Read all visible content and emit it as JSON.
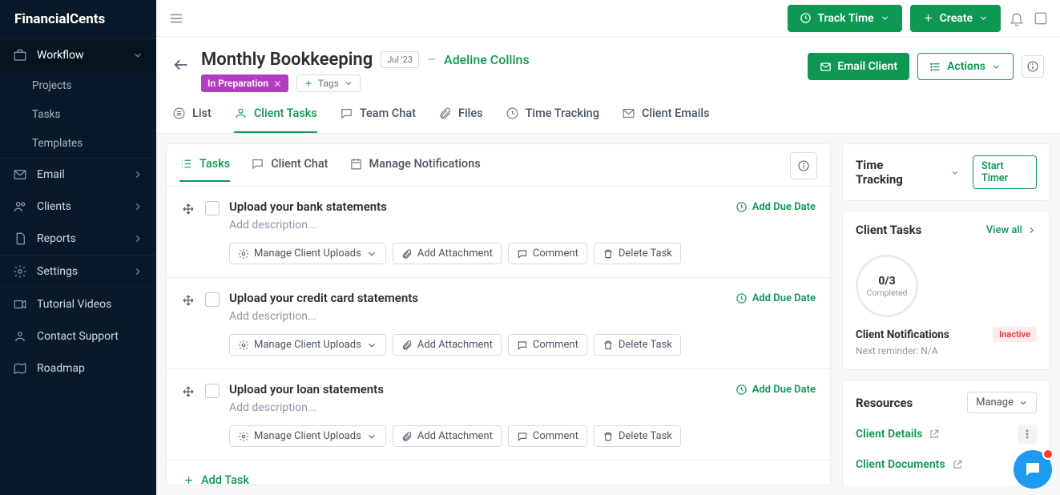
{
  "brand": "FinancialCents",
  "sidebar": {
    "workflow": "Workflow",
    "sub": {
      "projects": "Projects",
      "tasks": "Tasks",
      "templates": "Templates"
    },
    "email": "Email",
    "clients": "Clients",
    "reports": "Reports",
    "settings": "Settings",
    "tutorial": "Tutorial Videos",
    "support": "Contact Support",
    "roadmap": "Roadmap"
  },
  "top": {
    "trackTime": "Track Time",
    "create": "Create"
  },
  "header": {
    "title": "Monthly Bookkeeping",
    "period": "Jul '23",
    "client": "Adeline Collins",
    "status": "In Preparation",
    "tags": "Tags",
    "emailClient": "Email Client",
    "actions": "Actions"
  },
  "ptabs": {
    "list": "List",
    "clientTasks": "Client Tasks",
    "teamChat": "Team Chat",
    "files": "Files",
    "timeTracking": "Time Tracking",
    "clientEmails": "Client Emails"
  },
  "subtabs": {
    "tasks": "Tasks",
    "clientChat": "Client Chat",
    "manageNotif": "Manage Notifications"
  },
  "taskBtns": {
    "manageUploads": "Manage Client Uploads",
    "addAttachment": "Add Attachment",
    "comment": "Comment",
    "deleteTask": "Delete Task",
    "addDue": "Add Due Date",
    "desc": "Add description..."
  },
  "tasks": [
    {
      "title": "Upload your bank statements"
    },
    {
      "title": "Upload your credit card statements"
    },
    {
      "title": "Upload your loan statements"
    }
  ],
  "addTask": "Add Task",
  "right": {
    "timeTracking": "Time Tracking",
    "startTimer": "Start Timer",
    "clientTasks": "Client Tasks",
    "viewAll": "View all",
    "frac": "0/3",
    "completed": "Completed",
    "clientNotif": "Client Notifications",
    "inactive": "Inactive",
    "nextReminder": "Next reminder: N/A",
    "resources": "Resources",
    "manage": "Manage",
    "clientDetails": "Client Details",
    "clientDocuments": "Client Documents"
  }
}
